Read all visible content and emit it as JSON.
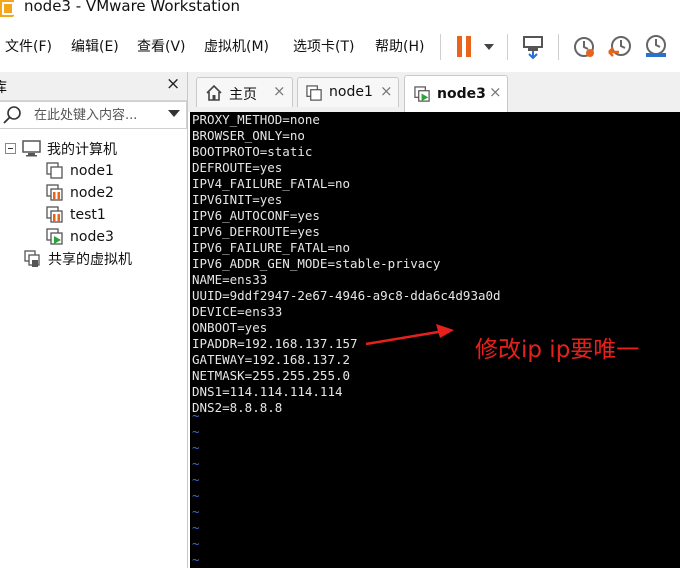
{
  "window": {
    "title": "node3 - VMware Workstation"
  },
  "menu": {
    "items": [
      "文件(F)",
      "编辑(E)",
      "查看(V)",
      "虚拟机(M)",
      "选项卡(T)",
      "帮助(H)"
    ]
  },
  "toolbar": {
    "icons": [
      "pause-icon",
      "dropdown-arrow-icon",
      "send-keys-icon",
      "snapshot-icon",
      "revert-snapshot-icon",
      "snapshot-manager-icon"
    ]
  },
  "library": {
    "title": "库",
    "close": "×",
    "search_placeholder": "在此处键入内容...",
    "tree": {
      "root": "我的计算机",
      "vms": [
        {
          "name": "node1",
          "state": "off"
        },
        {
          "name": "node2",
          "state": "suspended"
        },
        {
          "name": "test1",
          "state": "suspended"
        },
        {
          "name": "node3",
          "state": "running"
        }
      ],
      "shared": "共享的虚拟机"
    }
  },
  "tabs": [
    {
      "label": "主页",
      "icon": "home-icon",
      "close": "×",
      "active": false
    },
    {
      "label": "node1",
      "icon": "vm-icon",
      "close": "×",
      "active": false
    },
    {
      "label": "node3",
      "icon": "vm-running-icon",
      "close": "×",
      "active": true
    }
  ],
  "terminal": {
    "lines": [
      "PROXY_METHOD=none",
      "BROWSER_ONLY=no",
      "BOOTPROTO=static",
      "DEFROUTE=yes",
      "IPV4_FAILURE_FATAL=no",
      "IPV6INIT=yes",
      "IPV6_AUTOCONF=yes",
      "IPV6_DEFROUTE=yes",
      "IPV6_FAILURE_FATAL=no",
      "IPV6_ADDR_GEN_MODE=stable-privacy",
      "NAME=ens33",
      "UUID=9ddf2947-2e67-4946-a9c8-dda6c4d93a0d",
      "DEVICE=ens33",
      "ONBOOT=yes",
      "IPADDR=192.168.137.157",
      "GATEWAY=192.168.137.2",
      "NETMASK=255.255.255.0",
      "DNS1=114.114.114.114",
      "DNS2=8.8.8.8"
    ],
    "empty_line_marker": "~",
    "empty_line_count": 10
  },
  "annotation": {
    "text": "修改ip  ip要唯一",
    "color": "#e8201c"
  },
  "colors": {
    "accent_orange": "#e8631c",
    "terminal_bg": "#000000",
    "tilde": "#3b6fd6",
    "running_green": "#2aa33b"
  }
}
